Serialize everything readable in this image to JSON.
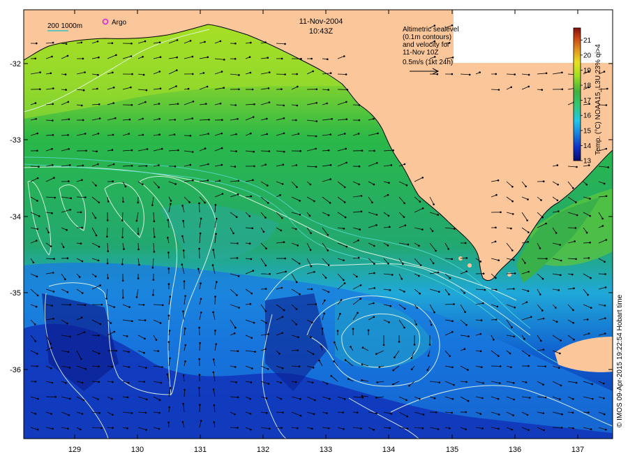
{
  "header": {
    "date": "11-Nov-2004",
    "time": "10:43Z"
  },
  "bathymetry_legend": {
    "label": "200  1000m",
    "color": "#36c2c2"
  },
  "argo_legend": {
    "label": "Argo",
    "color": "#e020e0"
  },
  "velocity_note": {
    "lines": [
      "Altimetric sealevel",
      "(0.1m contours)",
      "and velocity for",
      "11-Nov 10Z",
      "0.5m/s (1kt 24h)"
    ]
  },
  "colorbar": {
    "title": "Temp. (°C) NOAA15_L3U 23% qi>4",
    "ticks": [
      "13",
      "14",
      "15",
      "16",
      "17",
      "18",
      "19",
      "20",
      "21"
    ],
    "min": 13,
    "max": 21.8,
    "colors": [
      "#0a0a6e",
      "#1030c8",
      "#1a8ee0",
      "#20c8e8",
      "#30c870",
      "#40b040",
      "#a0e020",
      "#e8e020",
      "#e09020",
      "#c84010",
      "#801010"
    ]
  },
  "axes": {
    "x_ticks": [
      "129",
      "130",
      "131",
      "132",
      "133",
      "134",
      "135",
      "136",
      "137"
    ],
    "y_ticks": [
      "-32",
      "-33",
      "-34",
      "-35",
      "-36"
    ]
  },
  "credit": "© IMOS 09-Apr-2015 19:22:54 Hobart time",
  "colors": {
    "land": "#fbc79a",
    "ocean_north": "#9ad820",
    "ocean_mid": "#22b050",
    "ocean_south": "#1040c0",
    "contour": "#e8f8e8"
  }
}
